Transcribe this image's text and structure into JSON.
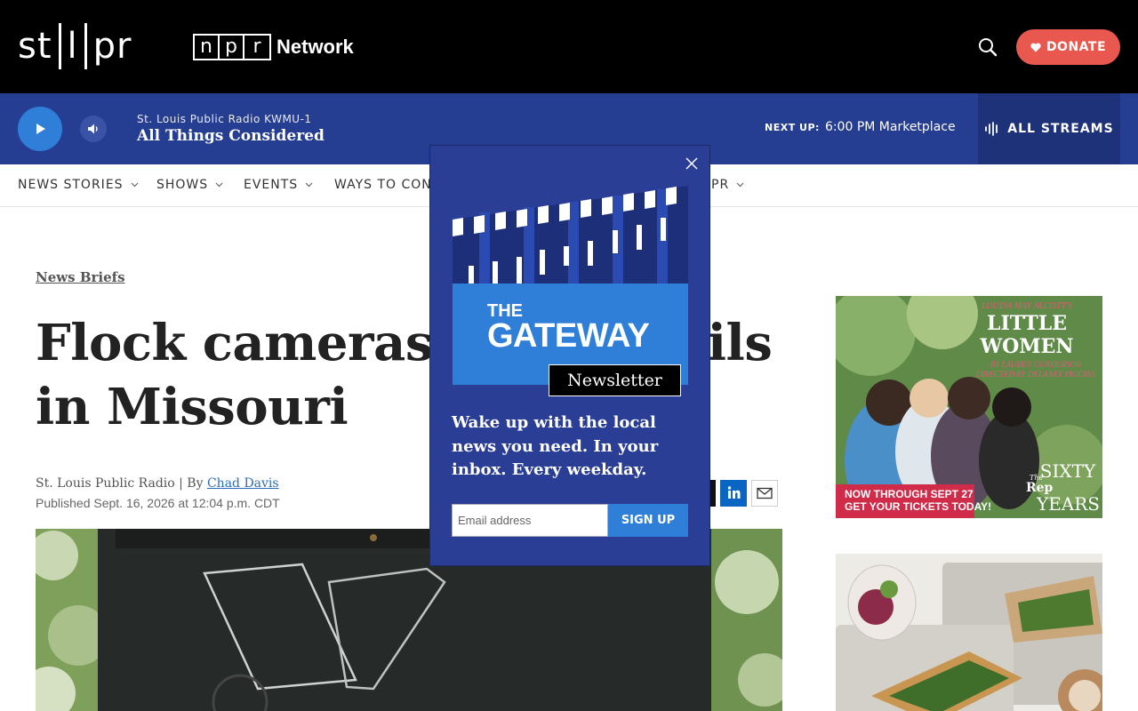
{
  "header": {
    "logo_letters": [
      "s",
      "t",
      "l",
      "p",
      "r"
    ],
    "npr_letters": [
      "n",
      "p",
      "r"
    ],
    "network_label": "Network",
    "donate_label": "DONATE"
  },
  "player": {
    "station": "St. Louis Public Radio KWMU-1",
    "program": "All Things Considered",
    "next_up_label": "NEXT UP:",
    "next_up_value": "6:00 PM Marketplace",
    "all_streams_label": "ALL STREAMS"
  },
  "nav": {
    "items": [
      "NEWS STORIES",
      "SHOWS",
      "EVENTS",
      "WAYS TO CONN",
      "PR"
    ]
  },
  "article": {
    "kicker": "News Briefs",
    "headline_line1_left": "Flock cameras to",
    "headline_line1_right": "ails",
    "headline_line2": "in Missouri",
    "byline_prefix": "St. Louis Public Radio | By ",
    "author": "Chad Davis",
    "published": "Published Sept. 16, 2026 at 12:04 p.m. CDT"
  },
  "ads": {
    "ad1": {
      "author_line": "LOUISA MAY ALCOTT'S",
      "title_line1": "LITTLE",
      "title_line2": "WOMEN",
      "credit1": "BY LAUREN GUNDERSON",
      "credit2": "DIRECTED BY DELANEY PIGGINS",
      "cta_line1": "NOW THROUGH SEPT 27",
      "cta_line2": "GET YOUR TICKETS TODAY!",
      "brand_the": "The",
      "brand_rep": "Rep",
      "sixty": "SIXTY",
      "years": "YEARS"
    }
  },
  "modal": {
    "the": "THE",
    "gateway": "GATEWAY",
    "badge": "Newsletter",
    "pitch": "Wake up with the local news you need. In your inbox. Every weekday.",
    "email_placeholder": "Email address",
    "signup_label": "SIGN UP"
  },
  "colors": {
    "player_bg": "#263e91",
    "donate": "#e8584f",
    "modal_bg": "#2a3e96",
    "signup": "#2f7fd8"
  }
}
